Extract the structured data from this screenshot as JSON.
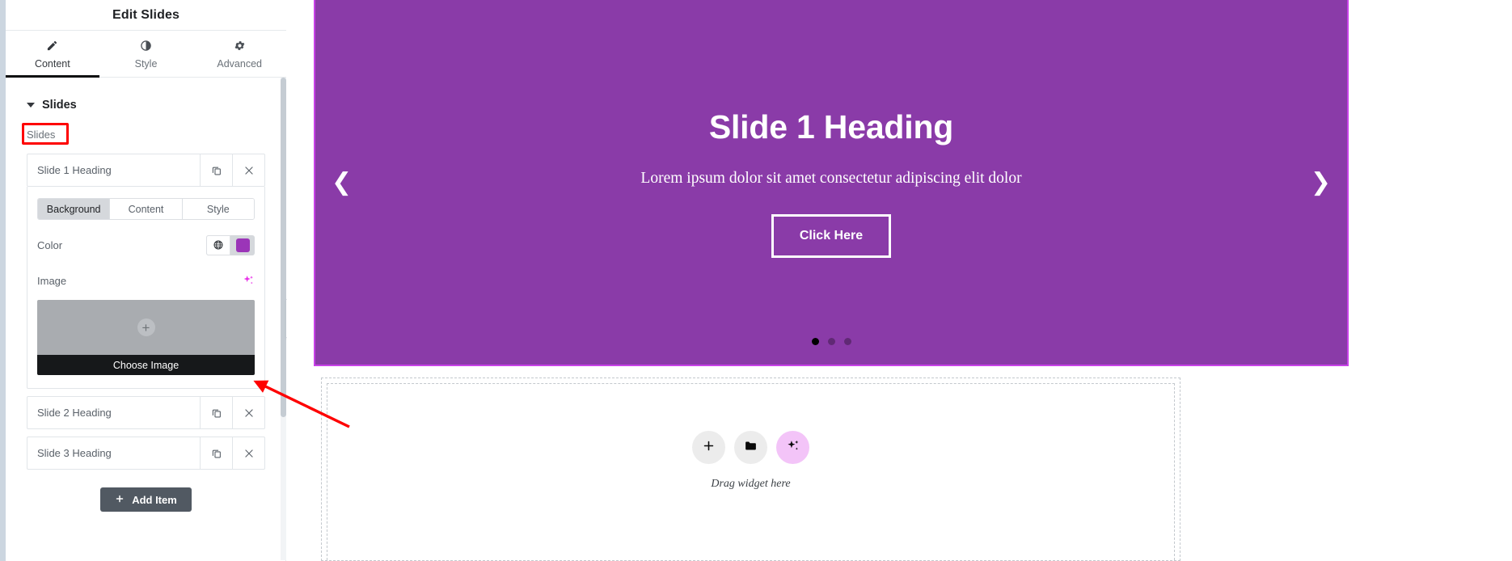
{
  "panel": {
    "title": "Edit Slides",
    "tabs": [
      {
        "label": "Content",
        "icon": "pencil-icon",
        "active": true
      },
      {
        "label": "Style",
        "icon": "contrast-icon",
        "active": false
      },
      {
        "label": "Advanced",
        "icon": "gear-icon",
        "active": false
      }
    ],
    "section": {
      "title": "Slides"
    },
    "field_label": "Slides",
    "repeater": {
      "items": [
        {
          "title": "Slide 1 Heading",
          "expanded": true
        },
        {
          "title": "Slide 2 Heading",
          "expanded": false
        },
        {
          "title": "Slide 3 Heading",
          "expanded": false
        }
      ],
      "duplicate_icon": "duplicate-icon",
      "remove_icon": "close-icon"
    },
    "item_editor": {
      "segments": [
        {
          "label": "Background",
          "active": true
        },
        {
          "label": "Content",
          "active": false
        },
        {
          "label": "Style",
          "active": false
        }
      ],
      "color": {
        "label": "Color",
        "global_icon": "globe-icon",
        "value": "#9b35b8"
      },
      "image": {
        "label": "Image",
        "ai_icon": "ai-sparkle-icon",
        "placeholder_icon": "plus-icon",
        "choose_label": "Choose Image"
      }
    },
    "add_item_label": "Add Item",
    "add_item_icon": "plus-icon",
    "collapse_icon": "chevron-left-icon"
  },
  "canvas": {
    "slide": {
      "heading": "Slide 1 Heading",
      "subheading": "Lorem ipsum dolor sit amet consectetur adipiscing elit dolor",
      "button_label": "Click Here",
      "background_color": "#8a3ba8",
      "selection_color": "#c842e8",
      "prev_icon": "chevron-left-icon",
      "next_icon": "chevron-right-icon",
      "dots": [
        {
          "active": true
        },
        {
          "active": false
        },
        {
          "active": false
        }
      ]
    },
    "dropzone": {
      "caption": "Drag widget here",
      "buttons": [
        {
          "icon": "plus-icon",
          "name": "add-element-button"
        },
        {
          "icon": "folder-icon",
          "name": "templates-button"
        },
        {
          "icon": "ai-sparkle-icon",
          "name": "ai-button"
        }
      ]
    }
  },
  "annotation": {
    "color": "#fe0000",
    "highlight_target": "Slides"
  }
}
